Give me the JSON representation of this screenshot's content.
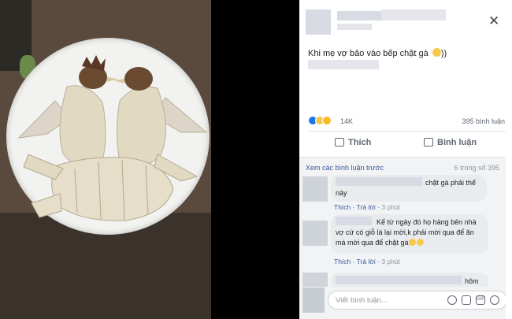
{
  "post": {
    "caption_text": "Khi mẹ vợ bảo vào bếp chặt gà ",
    "caption_suffix": "))",
    "reactions_count": "14K",
    "comments_count": "395 bình luận"
  },
  "actions": {
    "like_label": "Thích",
    "comment_label": "Bình luận"
  },
  "comments_section": {
    "view_previous": "Xem các bình luận trước",
    "page_count": "6 trong số 395",
    "items": [
      {
        "text": "chặt gà phải thế này",
        "like": "Thích",
        "reply": "Trả lời",
        "time": "3 phút"
      },
      {
        "text": "Kể từ ngày đó họ hàng bên nhà vợ cứ có giỗ là lại mời,k phải mời qua để ăn mà mời qua để chặt gà",
        "like": "Thích",
        "reply": "Trả lời",
        "time": "3 phút"
      },
      {
        "text": "hôm"
      }
    ]
  },
  "composer": {
    "placeholder": "Viết bình luận..."
  },
  "colors": {
    "link": "#385898",
    "like_blue": "#1877f2",
    "haha_yellow": "#f7c948"
  }
}
